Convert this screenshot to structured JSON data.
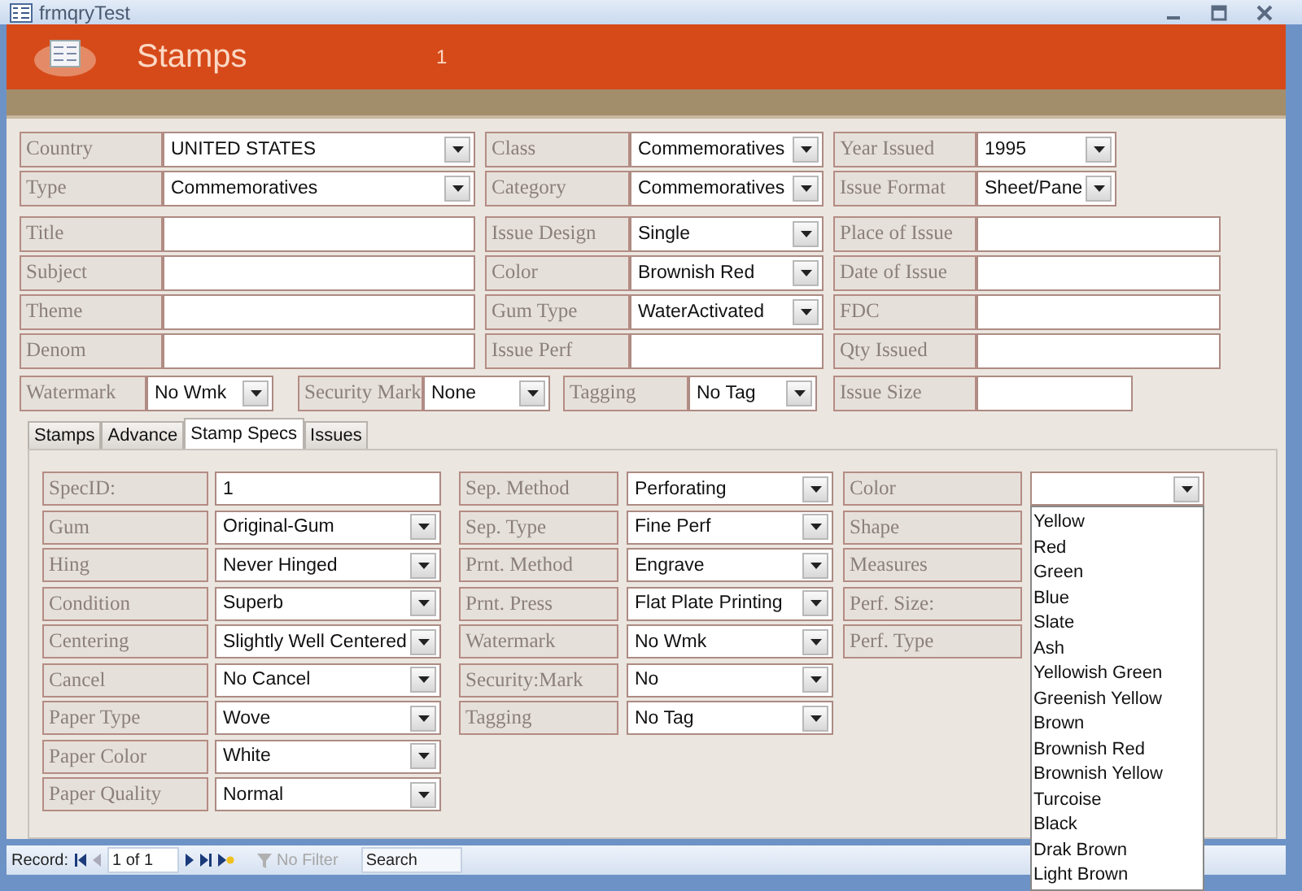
{
  "window": {
    "title": "frmqryTest"
  },
  "header": {
    "title": "Stamps",
    "record_number": "1"
  },
  "main_rows": [
    [
      {
        "label": "Country",
        "kind": "combo",
        "value": "UNITED STATES"
      },
      {
        "label": "Class",
        "kind": "combo",
        "value": "Commemoratives"
      },
      {
        "label": "Year Issued",
        "kind": "combo",
        "value": "1995"
      }
    ],
    [
      {
        "label": "Type",
        "kind": "combo",
        "value": "Commemoratives"
      },
      {
        "label": "Category",
        "kind": "combo",
        "value": "Commemoratives"
      },
      {
        "label": "Issue Format",
        "kind": "combo",
        "value": "Sheet/Pane"
      }
    ],
    [
      {
        "label": "Title",
        "kind": "text"
      },
      {
        "label": "Issue Design",
        "kind": "combo",
        "value": "Single"
      },
      {
        "label": "Place of Issue",
        "kind": "text"
      }
    ],
    [
      {
        "label": "Subject",
        "kind": "text"
      },
      {
        "label": "Color",
        "kind": "combo",
        "value": "Brownish Red"
      },
      {
        "label": "Date of Issue",
        "kind": "text"
      }
    ],
    [
      {
        "label": "Theme",
        "kind": "text"
      },
      {
        "label": "Gum Type",
        "kind": "combo",
        "value": "WaterActivated"
      },
      {
        "label": "FDC",
        "kind": "text"
      }
    ],
    [
      {
        "label": "Denom",
        "kind": "text"
      },
      {
        "label": "Issue Perf",
        "kind": "text"
      },
      {
        "label": "Qty Issued",
        "kind": "text"
      }
    ]
  ],
  "flag_row": [
    {
      "label": "Watermark",
      "kind": "combo",
      "value": "No Wmk"
    },
    {
      "label": "Security Mark",
      "kind": "combo",
      "value": "None"
    },
    {
      "label": "Tagging",
      "kind": "combo",
      "value": "No Tag"
    },
    {
      "label": "Issue Size",
      "kind": "text"
    }
  ],
  "tabs": [
    {
      "label": "Stamps",
      "selected": false
    },
    {
      "label": "Advance",
      "selected": false
    },
    {
      "label": "Stamp Specs",
      "selected": true
    },
    {
      "label": "Issues",
      "selected": false
    }
  ],
  "spec_columns": [
    {
      "fields": [
        {
          "label": "SpecID:",
          "kind": "text",
          "value": "1"
        },
        {
          "label": "Gum",
          "kind": "combo",
          "value": "Original-Gum"
        },
        {
          "label": "Hing",
          "kind": "combo",
          "value": "Never Hinged"
        },
        {
          "label": "Condition",
          "kind": "combo",
          "value": "Superb"
        },
        {
          "label": "Centering",
          "kind": "combo",
          "value": "Slightly Well Centered"
        },
        {
          "label": "Cancel",
          "kind": "combo",
          "value": "No Cancel"
        },
        {
          "label": "Paper Type",
          "kind": "combo",
          "value": "Wove"
        },
        {
          "label": "Paper Color",
          "kind": "combo",
          "value": "White"
        },
        {
          "label": "Paper Quality",
          "kind": "combo",
          "value": "Normal"
        }
      ]
    },
    {
      "fields": [
        {
          "label": "Sep. Method",
          "kind": "combo",
          "value": "Perforating"
        },
        {
          "label": "Sep. Type",
          "kind": "combo",
          "value": "Fine Perf"
        },
        {
          "label": "Prnt. Method",
          "kind": "combo",
          "value": "Engrave"
        },
        {
          "label": "Prnt. Press",
          "kind": "combo",
          "value": "Flat Plate Printing"
        },
        {
          "label": "Watermark",
          "kind": "combo",
          "value": "No Wmk"
        },
        {
          "label": "Security:Mark",
          "kind": "combo",
          "value": "No"
        },
        {
          "label": "Tagging",
          "kind": "combo",
          "value": "No Tag"
        }
      ]
    },
    {
      "fields": [
        {
          "label": "Color",
          "kind": "combo",
          "expanded": true,
          "options": [
            "Yellow",
            "Red",
            "Green",
            "Blue",
            "Slate",
            "Ash",
            "Yellowish Green",
            "Greenish Yellow",
            "Brown",
            "Brownish Red",
            "Brownish Yellow",
            "Turcoise",
            "Black",
            "Drak Brown",
            "Light Brown"
          ]
        },
        {
          "label": "Shape",
          "kind": "label"
        },
        {
          "label": "Measures",
          "kind": "label"
        },
        {
          "label": "Perf. Size:",
          "kind": "label"
        },
        {
          "label": "Perf. Type",
          "kind": "label"
        }
      ]
    }
  ],
  "status_bar": {
    "record_label": "Record:",
    "position": "1 of 1",
    "filter": {
      "label": "No Filter",
      "disabled": true
    },
    "search": {
      "placeholder": "Search"
    }
  }
}
